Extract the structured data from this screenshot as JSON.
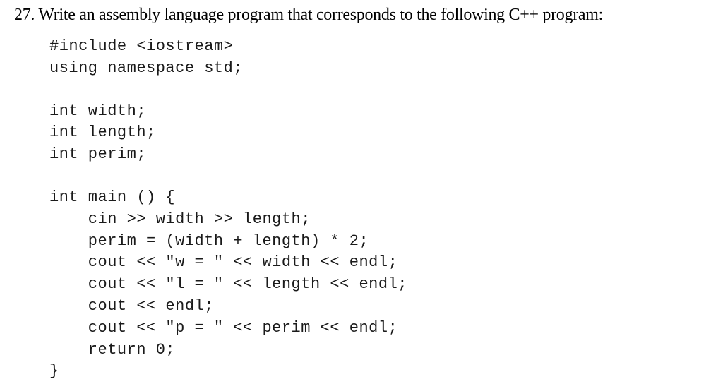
{
  "question": {
    "number": "27.",
    "text": "Write an assembly language program that corresponds to the following C++ program:"
  },
  "code": {
    "lines": [
      "#include <iostream>",
      "using namespace std;",
      "",
      "int width;",
      "int length;",
      "int perim;",
      "",
      "int main () {",
      "    cin >> width >> length;",
      "    perim = (width + length) * 2;",
      "    cout << \"w = \" << width << endl;",
      "    cout << \"l = \" << length << endl;",
      "    cout << endl;",
      "    cout << \"p = \" << perim << endl;",
      "    return 0;",
      "}"
    ]
  }
}
